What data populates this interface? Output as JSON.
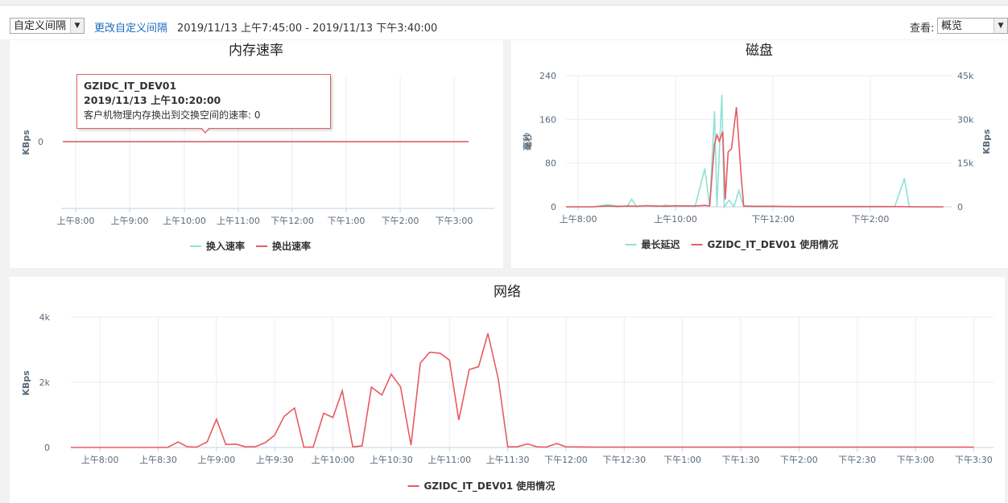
{
  "toolbar": {
    "interval_select": "自定义间隔",
    "change_interval_link": "更改自定义间隔",
    "time_range": "2019/11/13 上午7:45:00 - 2019/11/13 下午3:40:00",
    "view_label": "查看:",
    "view_select": "概览"
  },
  "colors": {
    "red": "#e85a61",
    "teal": "#8ee2d6",
    "grid": "#e9eef3",
    "axis": "#c8d2dc",
    "tick": "#5a6a7a"
  },
  "chart_data": [
    {
      "id": "memory",
      "type": "line",
      "title": "内存速率",
      "ylabel": "KBps",
      "x_ticks": [
        "上午8:00",
        "上午9:00",
        "上午10:00",
        "上午11:00",
        "下午12:00",
        "下午1:00",
        "下午2:00",
        "下午3:00"
      ],
      "y_ticks": [
        "0"
      ],
      "series": [
        {
          "name": "换入速率",
          "color": "#8ee2d6",
          "values": [
            0,
            0,
            0,
            0,
            0,
            0,
            0,
            0,
            0,
            0,
            0,
            0,
            0,
            0,
            0,
            0
          ]
        },
        {
          "name": "换出速率",
          "color": "#e85a61",
          "values": [
            0,
            0,
            0,
            0,
            0,
            0,
            0,
            0,
            0,
            0,
            0,
            0,
            0,
            0,
            0,
            0
          ]
        }
      ],
      "tooltip": {
        "title": "GZIDC_IT_DEV01",
        "time": "2019/11/13 上午10:20:00",
        "line": "客户机物理内存换出到交换空间的速率: 0"
      }
    },
    {
      "id": "disk",
      "type": "line",
      "title": "磁盘",
      "ylabel_left": "毫秒",
      "ylabel_right": "KBps",
      "y_left_ticks": [
        "240",
        "160",
        "80",
        "0"
      ],
      "y_right_ticks": [
        "45k",
        "30k",
        "15k",
        "0"
      ],
      "ylim_left": [
        0,
        240
      ],
      "ylim_right": [
        0,
        45000
      ],
      "x_ticks": [
        "上午8:00",
        "上午10:00",
        "下午12:00",
        "下午2:00"
      ],
      "xlim_hours": [
        7.75,
        15.67
      ],
      "series": [
        {
          "name": "最长延迟",
          "color": "#8ee2d6",
          "axis": "left",
          "points": [
            [
              7.75,
              0
            ],
            [
              8,
              0
            ],
            [
              8.3,
              0
            ],
            [
              8.6,
              4
            ],
            [
              8.8,
              2
            ],
            [
              9.0,
              0
            ],
            [
              9.1,
              14
            ],
            [
              9.2,
              0
            ],
            [
              9.4,
              2
            ],
            [
              9.6,
              0
            ],
            [
              9.8,
              3
            ],
            [
              10.0,
              0
            ],
            [
              10.2,
              2
            ],
            [
              10.4,
              0
            ],
            [
              10.6,
              70
            ],
            [
              10.7,
              0
            ],
            [
              10.8,
              175
            ],
            [
              10.85,
              0
            ],
            [
              10.95,
              205
            ],
            [
              11.0,
              0
            ],
            [
              11.1,
              12
            ],
            [
              11.2,
              0
            ],
            [
              11.3,
              30
            ],
            [
              11.4,
              0
            ],
            [
              11.6,
              0
            ],
            [
              12.0,
              0
            ],
            [
              13.0,
              0
            ],
            [
              14.0,
              0
            ],
            [
              14.5,
              0
            ],
            [
              14.7,
              52
            ],
            [
              14.8,
              0
            ],
            [
              15.0,
              0
            ],
            [
              15.5,
              0
            ]
          ]
        },
        {
          "name": "GZIDC_IT_DEV01 使用情况",
          "color": "#e85a61",
          "axis": "right",
          "points": [
            [
              7.75,
              0
            ],
            [
              8,
              0
            ],
            [
              8.3,
              0
            ],
            [
              8.6,
              300
            ],
            [
              8.8,
              100
            ],
            [
              9.0,
              300
            ],
            [
              9.2,
              200
            ],
            [
              9.4,
              400
            ],
            [
              9.6,
              300
            ],
            [
              9.8,
              200
            ],
            [
              10.0,
              400
            ],
            [
              10.2,
              300
            ],
            [
              10.4,
              300
            ],
            [
              10.6,
              500
            ],
            [
              10.7,
              300
            ],
            [
              10.8,
              21500
            ],
            [
              10.85,
              24700
            ],
            [
              10.9,
              22500
            ],
            [
              10.97,
              25800
            ],
            [
              11.02,
              2500
            ],
            [
              11.08,
              18800
            ],
            [
              11.15,
              20000
            ],
            [
              11.25,
              34200
            ],
            [
              11.35,
              10000
            ],
            [
              11.4,
              300
            ],
            [
              11.6,
              200
            ],
            [
              12.0,
              200
            ],
            [
              12.5,
              100
            ],
            [
              13.0,
              100
            ],
            [
              14.0,
              100
            ],
            [
              14.5,
              100
            ],
            [
              15.0,
              0
            ],
            [
              15.5,
              0
            ]
          ]
        }
      ]
    },
    {
      "id": "network",
      "type": "line",
      "title": "网络",
      "ylabel": "KBps",
      "y_ticks": [
        "4k",
        "2k",
        "0"
      ],
      "ylim": [
        0,
        4000
      ],
      "x_ticks": [
        "上午8:00",
        "上午8:30",
        "上午9:00",
        "上午9:30",
        "上午10:00",
        "上午10:30",
        "上午11:00",
        "上午11:30",
        "下午12:00",
        "下午12:30",
        "下午1:00",
        "下午1:30",
        "下午2:00",
        "下午2:30",
        "下午3:00",
        "下午3:30"
      ],
      "xlim_hours": [
        7.75,
        15.67
      ],
      "series": [
        {
          "name": "GZIDC_IT_DEV01 使用情况",
          "color": "#e85a61",
          "points": [
            [
              7.75,
              0
            ],
            [
              8.0,
              0
            ],
            [
              8.25,
              0
            ],
            [
              8.5,
              0
            ],
            [
              8.58,
              0
            ],
            [
              8.67,
              170
            ],
            [
              8.75,
              20
            ],
            [
              8.83,
              10
            ],
            [
              8.92,
              170
            ],
            [
              9.0,
              870
            ],
            [
              9.08,
              90
            ],
            [
              9.17,
              100
            ],
            [
              9.25,
              20
            ],
            [
              9.33,
              20
            ],
            [
              9.42,
              150
            ],
            [
              9.5,
              380
            ],
            [
              9.58,
              950
            ],
            [
              9.67,
              1210
            ],
            [
              9.75,
              10
            ],
            [
              9.83,
              10
            ],
            [
              9.92,
              1050
            ],
            [
              10.0,
              920
            ],
            [
              10.08,
              1740
            ],
            [
              10.17,
              20
            ],
            [
              10.25,
              50
            ],
            [
              10.33,
              1850
            ],
            [
              10.42,
              1610
            ],
            [
              10.5,
              2250
            ],
            [
              10.58,
              1860
            ],
            [
              10.67,
              70
            ],
            [
              10.75,
              2590
            ],
            [
              10.83,
              2920
            ],
            [
              10.92,
              2890
            ],
            [
              11.0,
              2680
            ],
            [
              11.08,
              840
            ],
            [
              11.17,
              2390
            ],
            [
              11.25,
              2480
            ],
            [
              11.33,
              3500
            ],
            [
              11.42,
              2090
            ],
            [
              11.5,
              20
            ],
            [
              11.58,
              20
            ],
            [
              11.67,
              110
            ],
            [
              11.75,
              20
            ],
            [
              11.83,
              10
            ],
            [
              11.92,
              120
            ],
            [
              12.0,
              20
            ],
            [
              12.25,
              10
            ],
            [
              12.5,
              10
            ],
            [
              13.0,
              10
            ],
            [
              13.5,
              10
            ],
            [
              14.0,
              10
            ],
            [
              14.5,
              10
            ],
            [
              15.0,
              10
            ],
            [
              15.5,
              10
            ]
          ]
        }
      ]
    }
  ]
}
